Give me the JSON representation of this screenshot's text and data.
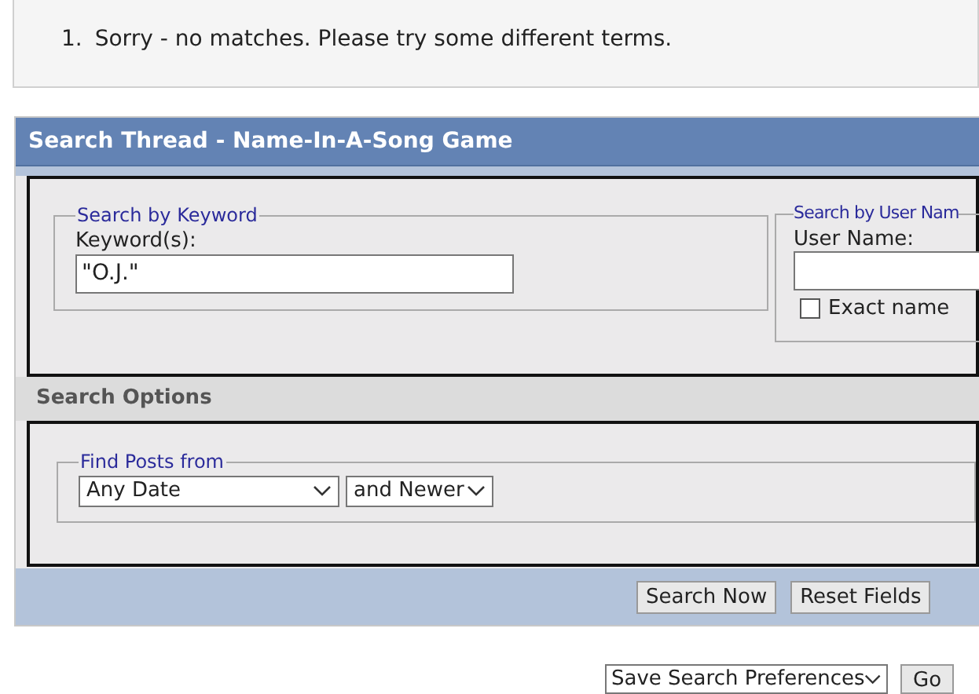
{
  "results": {
    "messages": [
      {
        "number": "1.",
        "text": "Sorry - no matches. Please try some different terms."
      }
    ]
  },
  "search_panel": {
    "title": "Search Thread - Name-In-A-Song Game",
    "keyword_group": {
      "legend": "Search by Keyword",
      "label": "Keyword(s):",
      "value": "\"O.J.\""
    },
    "user_group": {
      "legend": "Search by User Nam",
      "label": "User Name:",
      "exact_name": {
        "label": "Exact name",
        "checked": false
      }
    },
    "options_heading": "Search Options",
    "find_posts": {
      "legend": "Find Posts from",
      "date": "Any Date",
      "range": "and Newer"
    },
    "buttons": [
      "Search Now",
      "Reset Fields"
    ]
  },
  "footer": {
    "preferences": "Save Search Preferences",
    "go": "Go"
  }
}
